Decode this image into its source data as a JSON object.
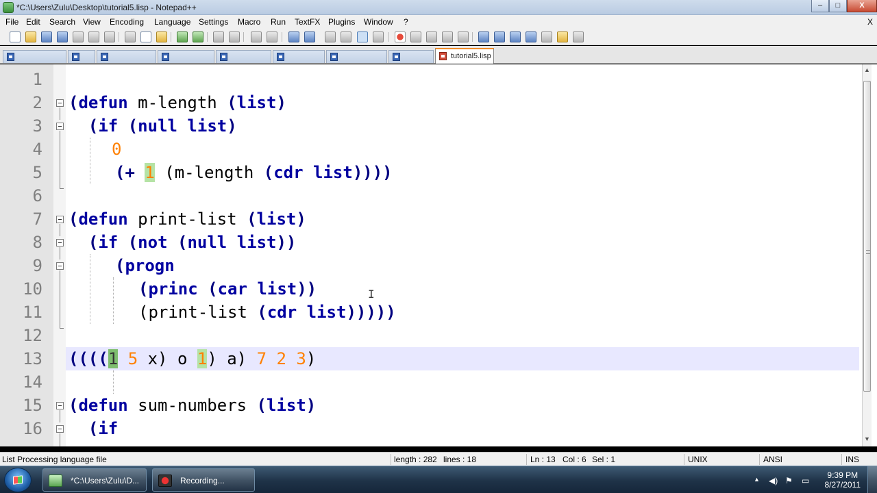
{
  "window": {
    "title": "*C:\\Users\\Zulu\\Desktop\\tutorial5.lisp - Notepad++",
    "minimize": "–",
    "maximize": "□",
    "close": "X"
  },
  "menu": [
    "File",
    "Edit",
    "Search",
    "View",
    "Encoding",
    "Language",
    "Settings",
    "Macro",
    "Run",
    "TextFX",
    "Plugins",
    "Window",
    "?"
  ],
  "menu_close": "X",
  "tabs": {
    "active_label": "tutorial5.lisp",
    "inactive_count": 8
  },
  "editor": {
    "line_numbers": [
      "1",
      "2",
      "3",
      "4",
      "5",
      "6",
      "7",
      "8",
      "9",
      "10",
      "11",
      "12",
      "13",
      "14",
      "15",
      "16"
    ],
    "current_line": 13,
    "caret_glyph": "I"
  },
  "code": {
    "l2": {
      "a": "(",
      "kw1": "defun",
      "b": " m-length ",
      "c": "(",
      "kw2": "list",
      "d": ")"
    },
    "l3": {
      "a": "  (",
      "kw1": "if",
      "b": " (",
      "kw2": "null",
      "c": " ",
      "kw3": "list",
      "d": ")"
    },
    "l4": {
      "num": "0"
    },
    "l5": {
      "a": "(+ ",
      "hl": "1",
      "b": " (m-length ",
      "c": "(",
      "kw": "cdr",
      "d": " ",
      "kw2": "list",
      "e": "))))"
    },
    "l7": {
      "a": "(",
      "kw1": "defun",
      "b": " print-list ",
      "c": "(",
      "kw2": "list",
      "d": ")"
    },
    "l8": {
      "a": "  (",
      "kw1": "if",
      "b": " (",
      "kw2": "not",
      "c": " (",
      "kw3": "null",
      "d": " ",
      "kw4": "list",
      "e": "))"
    },
    "l9": {
      "a": "(",
      "kw": "progn"
    },
    "l10": {
      "a": "(",
      "kw1": "princ",
      "b": " (",
      "kw2": "car",
      "c": " ",
      "kw3": "list",
      "d": "))"
    },
    "l11": {
      "a": "(print-list ",
      "b": "(",
      "kw1": "cdr",
      "c": " ",
      "kw2": "list",
      "d": ")))))"
    },
    "l13": {
      "a": "((((",
      "hlcur": "1",
      "n1": " 5",
      "b": " x) o ",
      "hl": "1",
      "c": ") a) ",
      "n2": "7 2 3",
      "d": ")"
    },
    "l15": {
      "a": "(",
      "kw1": "defun",
      "b": " sum-numbers ",
      "c": "(",
      "kw2": "list",
      "d": ")"
    },
    "l16": {
      "a": "  (",
      "kw1": "if"
    }
  },
  "status": {
    "file_type": "List Processing language file",
    "length": "length : 282",
    "lines": "lines : 18",
    "ln": "Ln : 13",
    "col": "Col : 6",
    "sel": "Sel : 1",
    "eol": "UNIX",
    "encoding": "ANSI",
    "mode": "INS"
  },
  "taskbar": {
    "items": [
      {
        "label": "*C:\\Users\\Zulu\\D...",
        "icon": "notepadpp-icon"
      },
      {
        "label": "Recording...",
        "icon": "recorder-icon"
      }
    ],
    "clock_time": "9:39 PM",
    "clock_date": "8/27/2011"
  },
  "colors": {
    "keyword": "#0000a0",
    "number": "#ff8000",
    "brace_match": "#b5e3a5",
    "current_line": "#e8e8ff"
  }
}
